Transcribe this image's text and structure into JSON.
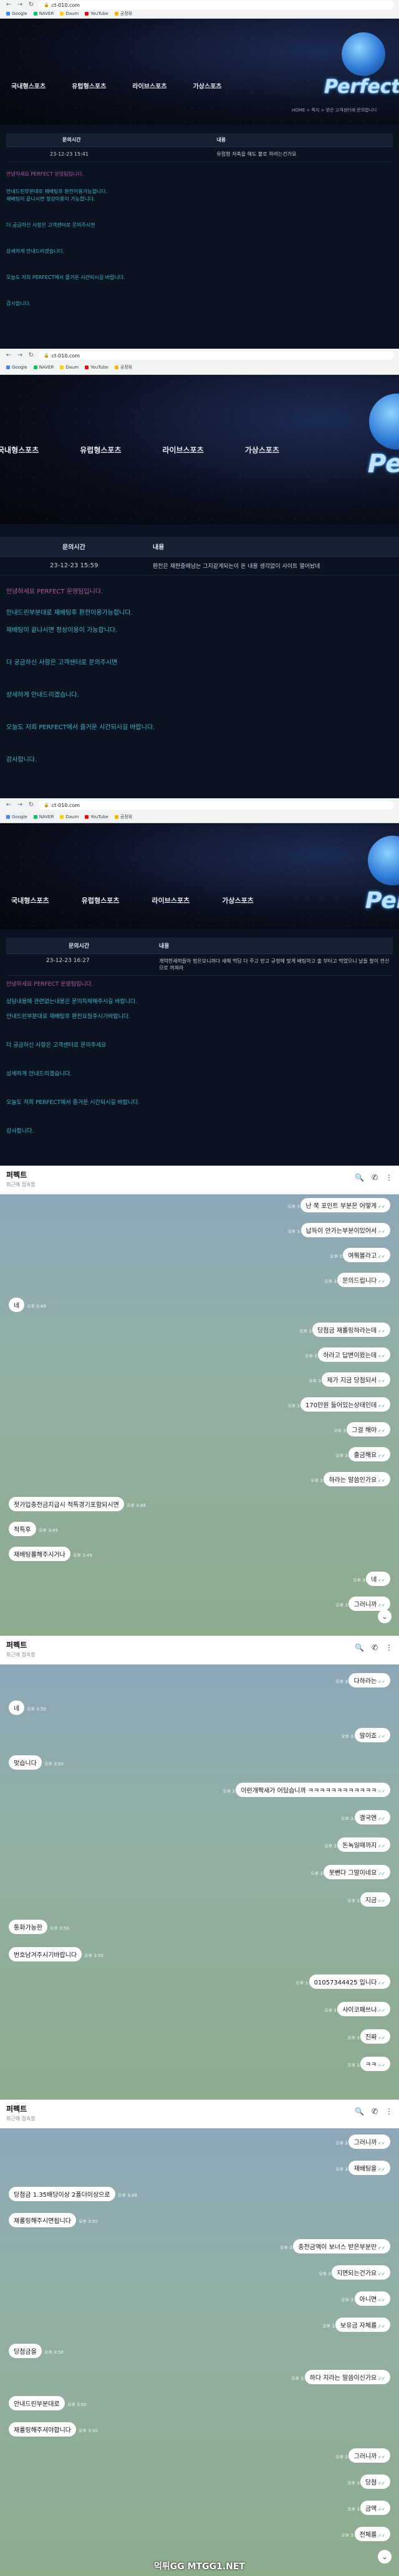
{
  "browser": {
    "url": "ct-010.com",
    "url_short": "ct-010.com",
    "bookmarks": [
      "Google",
      "NAVER",
      "Daum",
      "YouTube",
      "공정위"
    ]
  },
  "site": {
    "nav": [
      "국내형스포츠",
      "유럽형스포츠",
      "라이브스포츠",
      "가상스포츠"
    ],
    "logo": "Perfect",
    "breadcrumb": "HOME > 쪽지 > 받은 고객센터에 문의합니다",
    "columns": [
      "문의시간",
      "내용"
    ]
  },
  "shot1": {
    "time": "23-12-23 15:41",
    "content": "유럽형 저축을 해도 불로 하려는건가요"
  },
  "shot2": {
    "time": "23-12-23 15:59",
    "content": "환전은 재판중에남는 그지같게되는이 돈 내용 생각없이 사이트 열어놨네"
  },
  "shot3": {
    "time": "23-12-23 16:27",
    "content": "개억한새끼들아 법은모니까다 새해 먹답 다 주고 받고 규정에 맞게 배팅하고 출 부터고 먹었으니 날들 찰이 전신으로 꺼져라"
  },
  "notice_lines": [
    "안녕하세요 PERFECT 운영팀입니다.",
    "안내드린부분대로 재배팅후 환전이용가능합니다.",
    "재배팅이 끝나시면 정상이용이 가능합니다.",
    "더 궁금하신 사항은 고객센터로 문의주시면",
    "상세하게 안내드리겠습니다.",
    "오늘도 저희 PERFECT에서 즐거운 시간되시길 바랍니다.",
    "감사합니다."
  ],
  "notice_lines_3": [
    "안녕하세요 PERFECT 운영팀입니다.",
    "상담내용에 관련없는내용은 문의자제해주시길 바랍니다.",
    "안내드린부분대로 재배팅후 환전요청주시기바랍니다.",
    "더 궁금하신 사항은 고객센터로 문의주세요",
    "상세하게 안내드리겠습니다.",
    "오늘도 저희 PERFECT에서 즐거운 시간되시길 바랍니다.",
    "감사합니다."
  ],
  "chat": {
    "name": "퍼펙트",
    "status": "최근에 접속함",
    "panel1": [
      {
        "side": "out",
        "text": "난 쭉 포인트 부분은 어떻게",
        "time": "오후 3:49"
      },
      {
        "side": "out",
        "text": "납득이 안가는부분이있어서",
        "time": "오후 3:49"
      },
      {
        "side": "out",
        "text": "여쭤볼라고",
        "time": "오후 3:49"
      },
      {
        "side": "out",
        "text": "문의드립니다",
        "time": "오후 3:49"
      },
      {
        "side": "in",
        "text": "네",
        "time": "오후 3:49"
      },
      {
        "side": "out",
        "text": "당첨금 재롤링하라는데",
        "time": "오후 3:49"
      },
      {
        "side": "out",
        "text": "하라고 답변이왔는데",
        "time": "오후 3:49"
      },
      {
        "side": "out",
        "text": "제가 지금 당첨되서",
        "time": "오후 3:49"
      },
      {
        "side": "out",
        "text": "170만원 들어있는상태인데",
        "time": "오후 3:49"
      },
      {
        "side": "out",
        "text": "그걸 해야",
        "time": "오후 3:49"
      },
      {
        "side": "out",
        "text": "출금해요",
        "time": "오후 3:49"
      },
      {
        "side": "out",
        "text": "하라는 말씀인가요",
        "time": "오후 3:49"
      },
      {
        "side": "in",
        "text": "첫가입충전금지급시 적특경기포함되시면",
        "time": "오후 3:49"
      },
      {
        "side": "in",
        "text": "적특후",
        "time": "오후 3:49"
      },
      {
        "side": "in",
        "text": "재배팅롤해주시거나",
        "time": "오후 3:49"
      },
      {
        "side": "out",
        "text": "네",
        "time": "오후 3:50"
      },
      {
        "side": "out",
        "text": "그러니까",
        "time": "오후 3:50"
      }
    ],
    "panel2": [
      {
        "side": "out",
        "text": "다하라는",
        "time": "오후 3:50"
      },
      {
        "side": "in",
        "text": "네",
        "time": "오후 3:50"
      },
      {
        "side": "out",
        "text": "말이죠",
        "time": "오후 3:50"
      },
      {
        "side": "in",
        "text": "맞습니다",
        "time": "오후 3:50"
      },
      {
        "side": "out",
        "text": "이런개짝새가 어딨습니까 ㅋㅋㅋㅋㅋㅋㅋㅋㅋㅋㅋㅋ",
        "time": "오후 3:50"
      },
      {
        "side": "out",
        "text": "결국엔",
        "time": "오후 3:50"
      },
      {
        "side": "out",
        "text": "돈녹일때까지",
        "time": "오후 3:50"
      },
      {
        "side": "out",
        "text": "못뺀다 그말이네요",
        "time": "오후 3:50"
      },
      {
        "side": "out",
        "text": "지금",
        "time": "오후 3:50"
      },
      {
        "side": "in",
        "text": "통화가능한",
        "time": "오후 3:50"
      },
      {
        "side": "in",
        "text": "번호남겨주시기바랍니다",
        "time": "오후 3:50"
      },
      {
        "side": "out",
        "text": "01057344425 입니다",
        "time": "오후 3:50"
      },
      {
        "side": "out",
        "text": "사이코패쓰냐",
        "time": "오후 3:50"
      },
      {
        "side": "out",
        "text": "진짜",
        "time": "오후 3:50"
      },
      {
        "side": "out",
        "text": "ㅋㅋ",
        "time": "오후 3:50"
      }
    ],
    "panel3": [
      {
        "side": "out",
        "text": "그러니까",
        "time": "오후 3:50"
      },
      {
        "side": "out",
        "text": "재배팅을",
        "time": "오후 3:50"
      },
      {
        "side": "in",
        "text": "당첨금 1.35배당이상 2폴더이상으로",
        "time": "오후 3:49"
      },
      {
        "side": "in",
        "text": "재롤링해주시면됩니다",
        "time": "오후 3:50"
      },
      {
        "side": "out",
        "text": "충전금액이 보너스 받은부분만",
        "time": "오후 3:50"
      },
      {
        "side": "out",
        "text": "지면되는건가요",
        "time": "오후 3:50"
      },
      {
        "side": "out",
        "text": "아니면",
        "time": "오후 3:50"
      },
      {
        "side": "out",
        "text": "보유금 자체를",
        "time": "오후 3:50"
      },
      {
        "side": "in",
        "text": "당첨금을",
        "time": "오후 3:50"
      },
      {
        "side": "out",
        "text": "하다 지라는 말씀이신가요",
        "time": "오후 3:50"
      },
      {
        "side": "in",
        "text": "안내드린부분대로",
        "time": "오후 3:50"
      },
      {
        "side": "in",
        "text": "재롤링해주셔야합니다",
        "time": "오후 3:50"
      },
      {
        "side": "out",
        "text": "그러니까",
        "time": "오후 3:50"
      },
      {
        "side": "out",
        "text": "당첨",
        "time": "오후 3:50"
      },
      {
        "side": "out",
        "text": "금액",
        "time": "오후 3:50"
      },
      {
        "side": "out",
        "text": "전체를",
        "time": "오후 3:50"
      }
    ],
    "watermark": "먹튀GG MTGG1.NET"
  }
}
